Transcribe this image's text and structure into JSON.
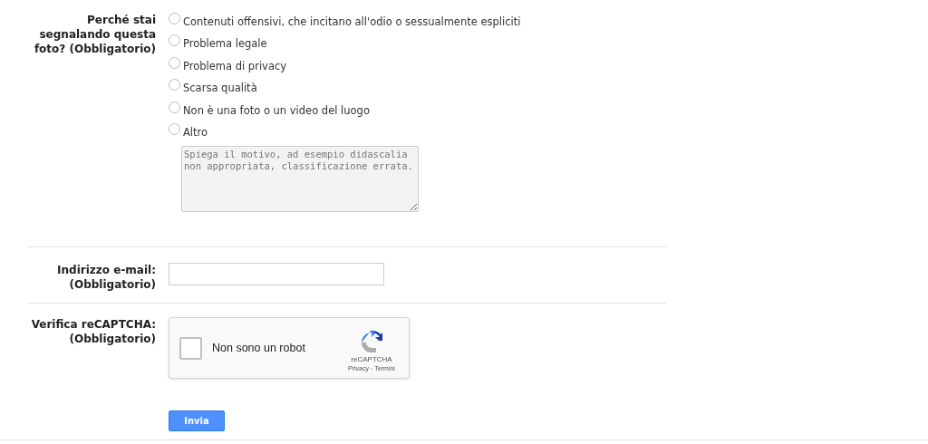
{
  "reason": {
    "label_lines": [
      "Perché stai segnalando questa",
      "foto? (Obbligatorio)"
    ],
    "options": [
      {
        "label": "Contenuti offensivi, che incitano all'odio o sessualmente espliciti",
        "selected": false
      },
      {
        "label": "Problema legale",
        "selected": false
      },
      {
        "label": "Problema di privacy",
        "selected": false
      },
      {
        "label": "Scarsa qualità",
        "selected": false
      },
      {
        "label": "Non è una foto o un video del luogo",
        "selected": false
      },
      {
        "label": "Altro",
        "selected": false
      }
    ],
    "details": {
      "placeholder": "Spiega il motivo, ad esempio didascalia non appropriata, classificazione errata."
    }
  },
  "email": {
    "label_lines": [
      "Indirizzo e-mail:",
      "(Obbligatorio)"
    ]
  },
  "captcha": {
    "label_lines": [
      "Verifica reCAPTCHA:",
      "(Obbligatorio)"
    ],
    "checkbox_label": "Non sono un robot",
    "checked": false,
    "brand": "reCAPTCHA",
    "links": [
      "Privacy",
      "-",
      "Termini"
    ]
  },
  "submit": "Invia"
}
